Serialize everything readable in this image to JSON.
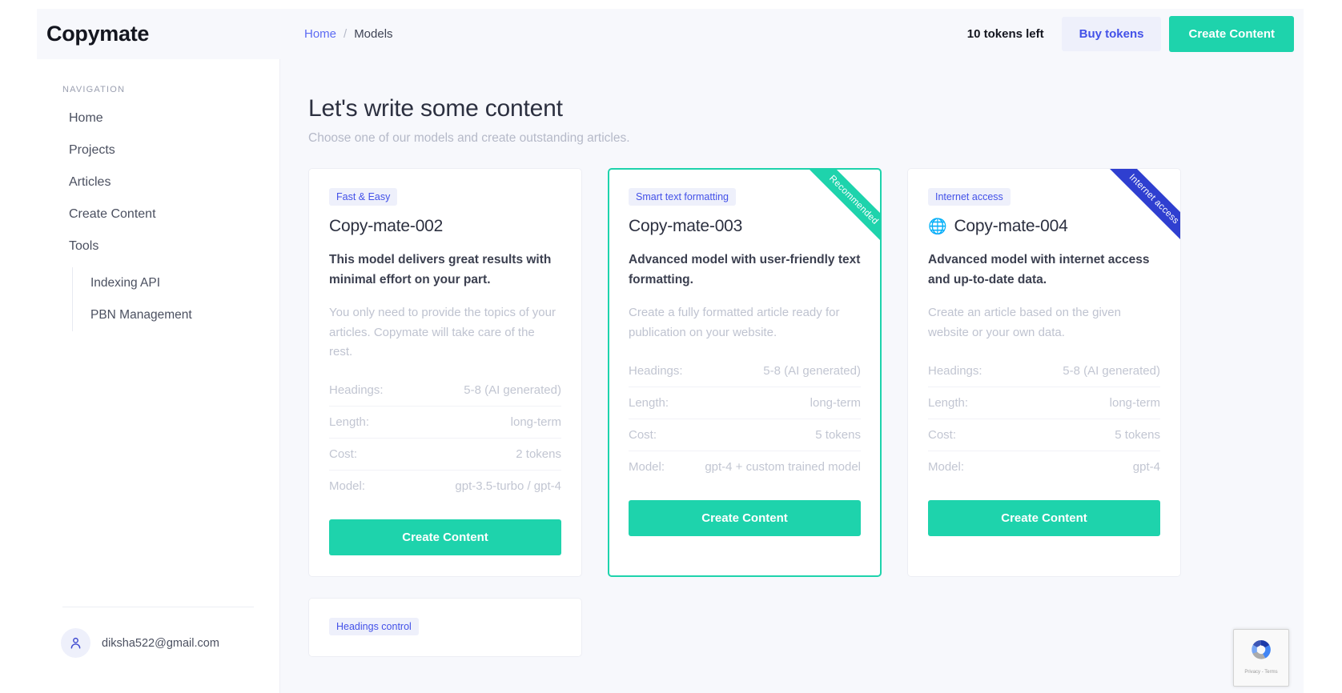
{
  "brand": "Copymate",
  "header": {
    "breadcrumb": {
      "home": "Home",
      "separator": "/",
      "current": "Models"
    },
    "tokens_left": "10 tokens left",
    "buy_tokens": "Buy tokens",
    "create_content": "Create Content",
    "accent": "#1ed3ac",
    "link_color": "#4351e8"
  },
  "sidebar": {
    "heading": "NAVIGATION",
    "items": [
      {
        "label": "Home"
      },
      {
        "label": "Projects"
      },
      {
        "label": "Articles"
      },
      {
        "label": "Create Content"
      },
      {
        "label": "Tools"
      }
    ],
    "sub_items": [
      {
        "label": "Indexing API"
      },
      {
        "label": "PBN Management"
      }
    ],
    "user_email": "diksha522@gmail.com"
  },
  "main": {
    "title": "Let's write some content",
    "subtitle": "Choose one of our models and create outstanding articles.",
    "cards": [
      {
        "badge": "Fast & Easy",
        "title": "Copy-mate-002",
        "lead": "This model delivers great results with minimal effort on your part.",
        "desc": "You only need to provide the topics of your articles. Copymate will take care of the rest.",
        "specs": [
          {
            "key": "Headings:",
            "value": "5-8 (AI generated)"
          },
          {
            "key": "Length:",
            "value": "long-term"
          },
          {
            "key": "Cost:",
            "value": "2 tokens"
          },
          {
            "key": "Model:",
            "value": "gpt-3.5-turbo / gpt-4"
          }
        ],
        "cta": "Create Content",
        "ribbon": null,
        "featured": false,
        "icon": null
      },
      {
        "badge": "Smart text formatting",
        "title": "Copy-mate-003",
        "lead": "Advanced model with user-friendly text formatting.",
        "desc": "Create a fully formatted article ready for publication on your website.",
        "specs": [
          {
            "key": "Headings:",
            "value": "5-8 (AI generated)"
          },
          {
            "key": "Length:",
            "value": "long-term"
          },
          {
            "key": "Cost:",
            "value": "5 tokens"
          },
          {
            "key": "Model:",
            "value": "gpt-4 + custom trained model"
          }
        ],
        "cta": "Create Content",
        "ribbon": "Recommended",
        "ribbon_color": "#1ed3ac",
        "featured": true,
        "icon": null
      },
      {
        "badge": "Internet access",
        "title": "Copy-mate-004",
        "lead": "Advanced model with internet access and up-to-date data.",
        "desc": "Create an article based on the given website or your own data.",
        "specs": [
          {
            "key": "Headings:",
            "value": "5-8 (AI generated)"
          },
          {
            "key": "Length:",
            "value": "long-term"
          },
          {
            "key": "Cost:",
            "value": "5 tokens"
          },
          {
            "key": "Model:",
            "value": "gpt-4"
          }
        ],
        "cta": "Create Content",
        "ribbon": "Internet access",
        "ribbon_color": "#2f3fd0",
        "featured": false,
        "icon": "globe-icon"
      }
    ],
    "card_row2": {
      "badge": "Headings control"
    }
  },
  "recaptcha": {
    "privacy": "Privacy",
    "separator": "-",
    "terms": "Terms"
  }
}
